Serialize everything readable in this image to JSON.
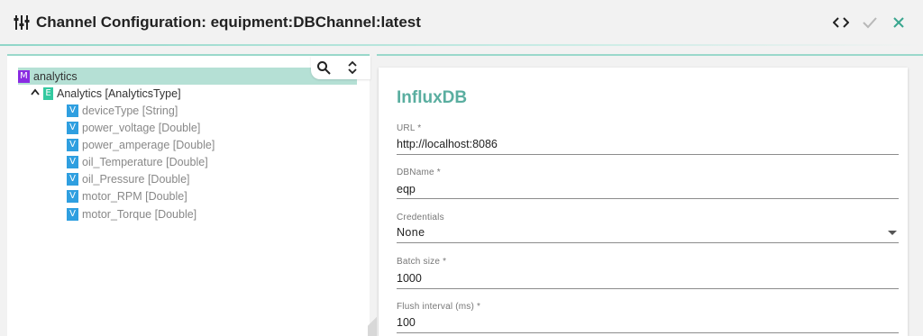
{
  "window": {
    "title": "Channel Configuration: equipment:DBChannel:latest",
    "icons": {
      "title": "sliders-icon",
      "code": "code-icon",
      "apply": "check-icon",
      "close": "close-icon"
    },
    "colors": {
      "accent": "#5aaea0",
      "selected_row": "#b5e0d5",
      "model_badge": "#8a2be2",
      "entity_badge": "#33c9a0",
      "variable_badge": "#2f9fe0"
    }
  },
  "tree": {
    "model": {
      "badge": "M",
      "label": "analytics"
    },
    "entity": {
      "badge": "E",
      "label": "Analytics [AnalyticsType]"
    },
    "variables": [
      {
        "badge": "V",
        "label": "deviceType [String]"
      },
      {
        "badge": "V",
        "label": "power_voltage [Double]"
      },
      {
        "badge": "V",
        "label": "power_amperage [Double]"
      },
      {
        "badge": "V",
        "label": "oil_Temperature [Double]"
      },
      {
        "badge": "V",
        "label": "oil_Pressure [Double]"
      },
      {
        "badge": "V",
        "label": "motor_RPM [Double]"
      },
      {
        "badge": "V",
        "label": "motor_Torque [Double]"
      }
    ],
    "tools": {
      "search": "search-icon",
      "expand": "expand-collapse-icon"
    }
  },
  "form": {
    "title": "InfluxDB",
    "fields": [
      {
        "label": "URL *",
        "value": "http://localhost:8086"
      },
      {
        "label": "DBName *",
        "value": "eqp"
      },
      {
        "label": "Credentials",
        "value": "None"
      },
      {
        "label": "Batch size *",
        "value": "1000"
      },
      {
        "label": "Flush interval (ms) *",
        "value": "100"
      }
    ]
  }
}
